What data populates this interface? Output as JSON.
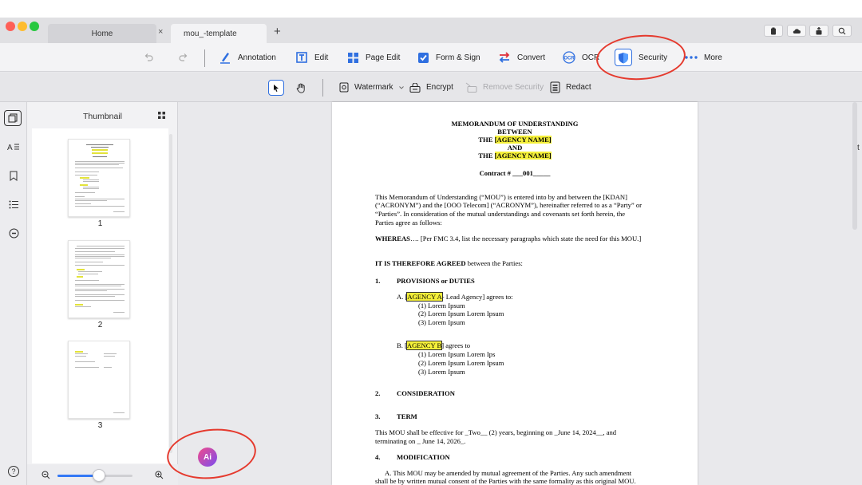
{
  "tabs": {
    "home_label": "Home",
    "close_glyph": "×",
    "doc_label": "mou_-template",
    "add_glyph": "+"
  },
  "toolbar": {
    "annotation": "Annotation",
    "edit": "Edit",
    "page_edit": "Page Edit",
    "form_sign": "Form & Sign",
    "convert": "Convert",
    "ocr": "OCR",
    "security": "Security",
    "more": "More"
  },
  "security_toolbar": {
    "watermark": "Watermark",
    "encrypt": "Encrypt",
    "remove_security": "Remove Security",
    "redact": "Redact"
  },
  "thumbnail_panel": {
    "title": "Thumbnail",
    "pages": [
      "1",
      "2",
      "3"
    ],
    "zoom_level": 0.55
  },
  "document": {
    "title_lines": [
      "MEMORANDUM OF UNDERSTANDING",
      "BETWEEN"
    ],
    "the_word": "THE",
    "agency_name": "[AGENCY NAME]",
    "and_word": "AND",
    "contract_label": "Contract #",
    "contract_number": "___001_____",
    "intro_lines": [
      "This Memorandum of Understanding (“MOU”) is entered into by and between the [KDAN]",
      "(“ACRONYM”) and the [OOO Telecom] (“ACRONYM”), hereinafter referred to as a “Party” or",
      "“Parties”. In consideration of the mutual understandings and covenants set forth herein, the",
      "Parties agree as follows:"
    ],
    "whereas_bold": "WHEREAS",
    "whereas_text": "…. [Per FMC 3.4, list the necessary paragraphs which state the need for this MOU.]",
    "agreed_bold": "IT IS THEREFORE AGREED",
    "agreed_text": " between the Parties:",
    "section1_num": "1.",
    "section1_title": "PROVISIONS or DUTIES",
    "agency_a_prefix": "A. [",
    "agency_a": "AGENCY A",
    "agency_a_suffix": "- Lead Agency] agrees to:",
    "agency_a_items": [
      "(1) Lorem Ipsum",
      "(2) Lorem Ipsum Lorem Ipsum",
      "(3) Lorem Ipsum"
    ],
    "agency_b_prefix": "B. [",
    "agency_b": "AGENCY B",
    "agency_b_suffix": "] agrees to",
    "agency_b_items": [
      "(1) Lorem Ipsum Lorem Ips",
      "(2) Lorem Ipsum Lorem Ipsum",
      "(3) Lorem Ipsum"
    ],
    "section2_num": "2.",
    "section2_title": "CONSIDERATION",
    "section3_num": "3.",
    "section3_title": "TERM",
    "term_lines": [
      "This MOU shall be effective for _Two__ (2) years, beginning on _June 14, 2024__, and",
      "terminating on _ June 14, 2026_."
    ],
    "section4_num": "4.",
    "section4_title": "MODIFICATION",
    "modification_lines": [
      "A. This MOU may be amended by mutual agreement of the Parties. Any such amendment",
      "shall be by written mutual consent of the Parties with the same formality as this original MOU."
    ]
  },
  "ai_button_label": "Ai",
  "help_glyph": "?",
  "edge_glyph": "t",
  "colors": {
    "accent": "#3478f6",
    "highlight": "#f5f03a",
    "annotation_ring": "#e53a2e"
  }
}
